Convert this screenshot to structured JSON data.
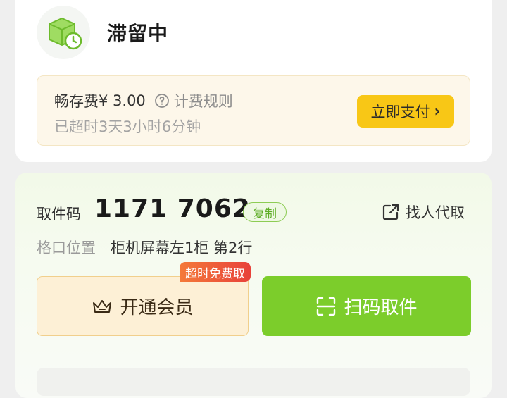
{
  "status": {
    "title": "滞留中",
    "icon": "package-clock-icon"
  },
  "fee": {
    "label": "畅存费",
    "amount": "¥ 3.00",
    "rule_text": "计费规则",
    "rule_icon": "question-circle-icon",
    "overtime_text": "已超时3天3小时6分钟",
    "pay_button": "立即支付",
    "pay_chevron": "›"
  },
  "pickup": {
    "code_label": "取件码",
    "code_value": "1171 7062",
    "copy_label": "复制",
    "proxy_label": "找人代取",
    "proxy_icon": "share-icon",
    "location_label": "格口位置",
    "location_value": "柜机屏幕左1柜 第2行"
  },
  "actions": {
    "vip_label": "开通会员",
    "vip_icon": "crown-icon",
    "free_badge": "超时免费取",
    "scan_label": "扫码取件",
    "scan_icon": "scan-icon"
  },
  "colors": {
    "accent_green": "#7ccd2b",
    "pay_yellow": "#f8c716",
    "badge_red": "#e8413a"
  }
}
